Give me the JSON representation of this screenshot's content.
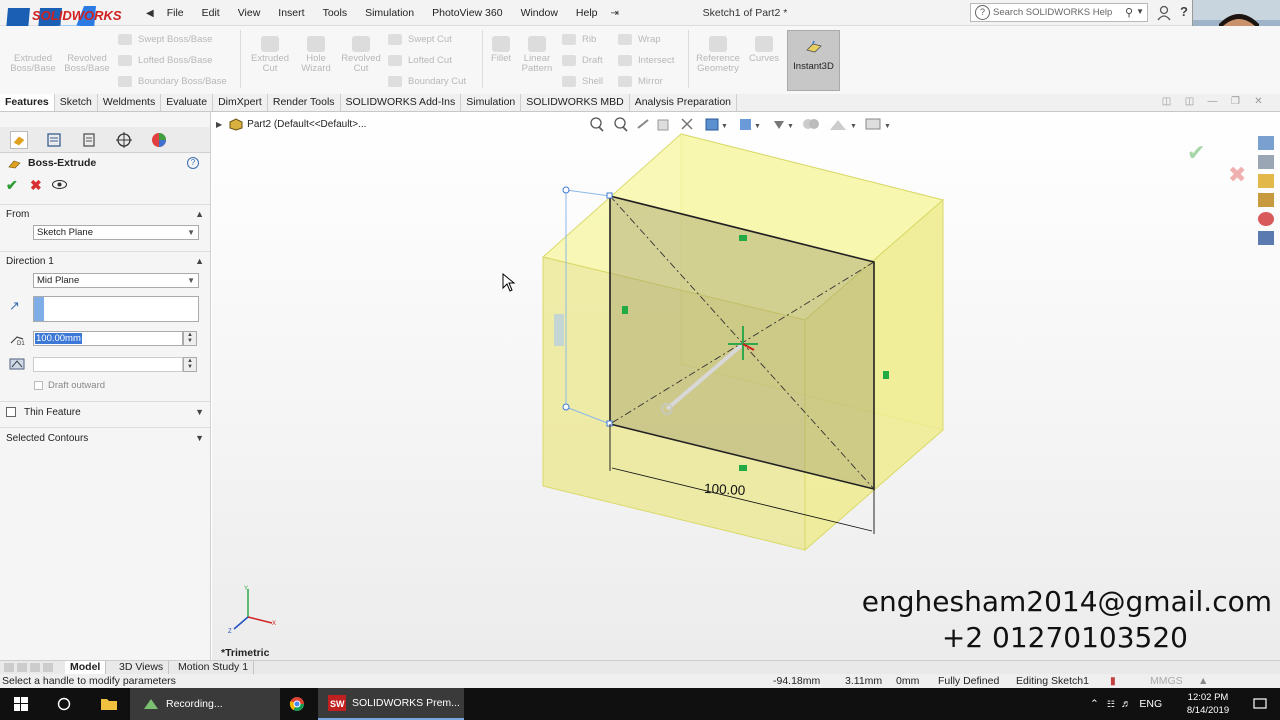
{
  "window": {
    "title": "Sketch1 of Part2 *",
    "search_placeholder": "Search SOLIDWORKS Help",
    "logo_text": "SOLIDWORKS"
  },
  "menu": [
    "File",
    "Edit",
    "View",
    "Insert",
    "Tools",
    "Simulation",
    "PhotoView 360",
    "Window",
    "Help"
  ],
  "commands": {
    "extruded_boss": "Extruded Boss/Base",
    "revolved_boss": "Revolved Boss/Base",
    "swept_boss": "Swept Boss/Base",
    "lofted_boss": "Lofted Boss/Base",
    "boundary_boss": "Boundary Boss/Base",
    "extruded_cut": "Extruded Cut",
    "hole_wizard": "Hole Wizard",
    "revolved_cut": "Revolved Cut",
    "swept_cut": "Swept Cut",
    "lofted_cut": "Lofted Cut",
    "boundary_cut": "Boundary Cut",
    "fillet": "Fillet",
    "linear_pattern": "Linear Pattern",
    "rib": "Rib",
    "draft": "Draft",
    "shell": "Shell",
    "wrap": "Wrap",
    "intersect": "Intersect",
    "mirror": "Mirror",
    "reference_geometry": "Reference Geometry",
    "curves": "Curves",
    "instant3d": "Instant3D"
  },
  "tabs": [
    "Features",
    "Sketch",
    "Weldments",
    "Evaluate",
    "DimXpert",
    "Render Tools",
    "SOLIDWORKS Add-Ins",
    "Simulation",
    "SOLIDWORKS MBD",
    "Analysis Preparation"
  ],
  "property_manager": {
    "title": "Boss-Extrude",
    "from_label": "From",
    "from_value": "Sketch Plane",
    "direction_label": "Direction 1",
    "direction_value": "Mid Plane",
    "depth_value": "100.00mm",
    "draft_outward": "Draft outward",
    "thin_feature": "Thin Feature",
    "selected_contours": "Selected Contours"
  },
  "viewport": {
    "tree_root": "Part2  (Default<<Default>...",
    "view_name": "*Trimetric",
    "dimension": "100.00",
    "watermark_email": "enghesham2014@gmail.com",
    "watermark_phone": "+2 01270103520"
  },
  "bottom_tabs": [
    "Model",
    "3D Views",
    "Motion Study 1"
  ],
  "status": {
    "message": "Select a handle to modify parameters",
    "x": "-94.18mm",
    "y": "3.11mm",
    "z": "0mm",
    "state": "Fully Defined",
    "editing": "Editing Sketch1",
    "units": "MMGS"
  },
  "taskbar": {
    "recording": "Recording...",
    "solidworks": "SOLIDWORKS Prem...",
    "lang": "ENG",
    "time": "12:02 PM",
    "date": "8/14/2019"
  },
  "colors": {
    "accent": "#3c78d8",
    "ok": "#2d9c35",
    "cancel": "#d93030",
    "body_fill": "#f7f59a",
    "body_edge": "#d9d96a"
  }
}
